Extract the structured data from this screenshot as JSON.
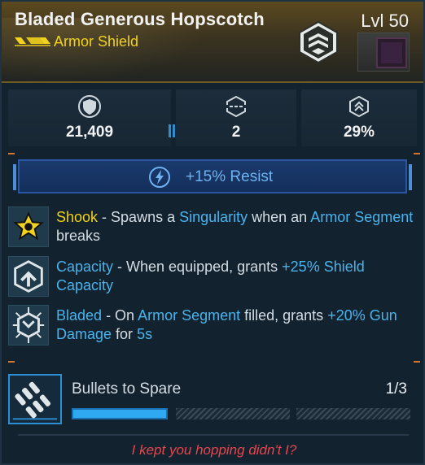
{
  "item": {
    "name": "Bladed Generous Hopscotch",
    "type": "Armor Shield",
    "level": "Lvl 50",
    "rarity_color": "#f2d21c"
  },
  "stats": [
    {
      "icon": "shield-capacity-icon",
      "value": "21,409"
    },
    {
      "icon": "armor-segments-icon",
      "value": "2"
    },
    {
      "icon": "recharge-rate-icon",
      "value": "29%"
    }
  ],
  "resist": {
    "icon": "lightning-resist-icon",
    "text": "+15% Resist"
  },
  "perks": [
    {
      "icon": "shook-perk-icon",
      "name": "Shook",
      "parts": [
        " - Spawns a ",
        "Singularity",
        " when an ",
        "Armor Segment",
        " breaks"
      ]
    },
    {
      "icon": "capacity-perk-icon",
      "name": "Capacity",
      "parts": [
        " - When equipped, grants ",
        "+25% Shield Capacity"
      ]
    },
    {
      "icon": "bladed-perk-icon",
      "name": "Bladed",
      "parts": [
        " - On ",
        "Armor Segment",
        " filled, grants ",
        "+20% Gun Damage",
        " for ",
        "5s"
      ]
    }
  ],
  "challenge": {
    "icon": "bullets-icon",
    "title": "Bullets to Spare",
    "count": "1/3",
    "progress": 0.333
  },
  "flavor_text": "I kept you hopping didn't I?",
  "colors": {
    "accent_blue": "#4ab3ec",
    "legendary_gold": "#f2d21c",
    "flavor_red": "#e8454c"
  }
}
